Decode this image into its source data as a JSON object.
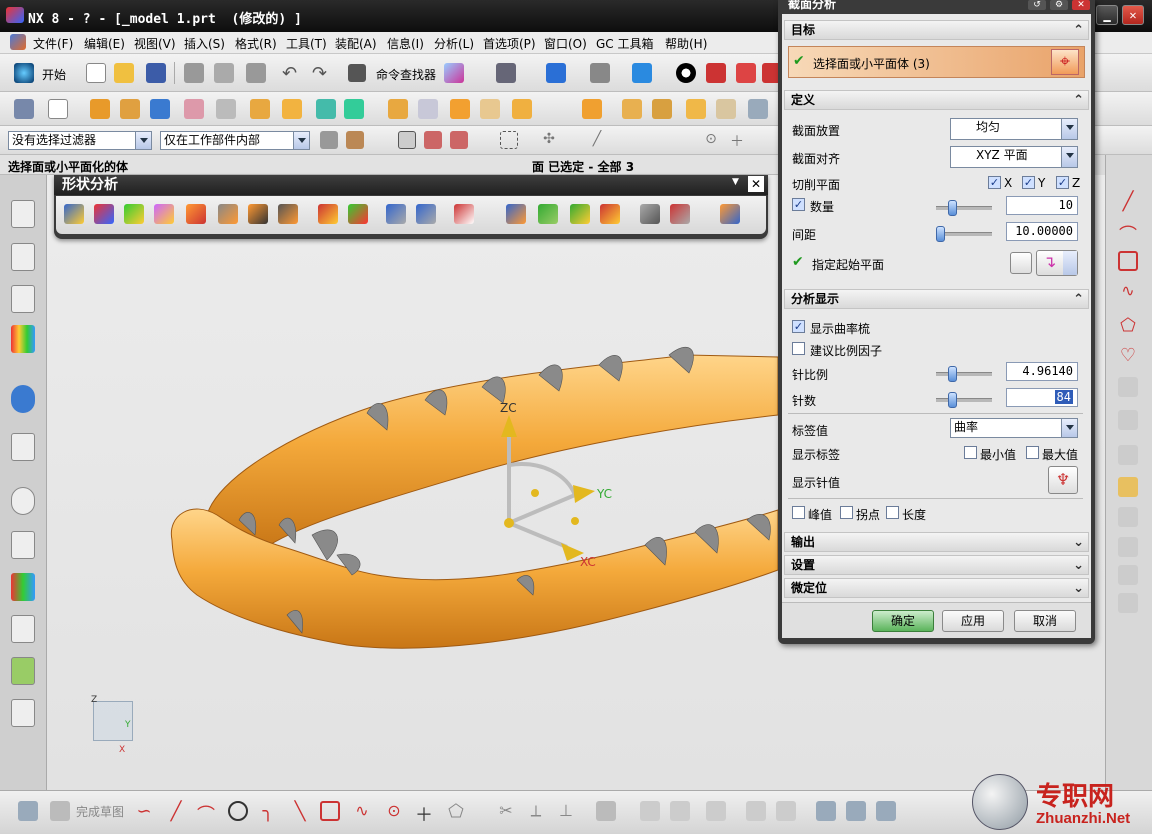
{
  "window": {
    "title": "NX 8 - ? - [_model 1.prt  (修改的) ]"
  },
  "menu": [
    "文件(F)",
    "编辑(E)",
    "视图(V)",
    "插入(S)",
    "格式(R)",
    "工具(T)",
    "装配(A)",
    "信息(I)",
    "分析(L)",
    "首选项(P)",
    "窗口(O)",
    "GC 工具箱",
    "帮助(H)"
  ],
  "toolbar": {
    "start_label": "开始",
    "command_finder_label": "命令查找器"
  },
  "filters": {
    "selection_filter": "没有选择过滤器",
    "scope": "仅在工作部件内部"
  },
  "status": {
    "prompt": "选择面或小平面化的体",
    "selection_info": "面 已选定 - 全部 3"
  },
  "shape_analysis": {
    "title": "形状分析"
  },
  "viewport": {
    "axis_zc": "ZC",
    "axis_yc": "YC",
    "axis_xc": "XC",
    "triad_z": "Z",
    "triad_y": "Y",
    "triad_x": "X"
  },
  "dialog": {
    "title": "截面分析",
    "target": {
      "header": "目标",
      "select_label": "选择面或小平面体 (3)"
    },
    "definition": {
      "header": "定义",
      "placement_label": "截面放置",
      "placement_value": "均匀",
      "alignment_label": "截面对齐",
      "alignment_value": "XYZ 平面",
      "cut_plane_label": "切削平面",
      "x": "X",
      "y": "Y",
      "z": "Z",
      "count_label": "数量",
      "count_value": "10",
      "spacing_label": "间距",
      "spacing_value": "10.00000",
      "start_plane_label": "指定起始平面"
    },
    "display": {
      "header": "分析显示",
      "show_comb_label": "显示曲率梳",
      "suggest_scale_label": "建议比例因子",
      "needle_scale_label": "针比例",
      "needle_scale_value": "4.96140",
      "needle_count_label": "针数",
      "needle_count_value": "84",
      "label_value_label": "标签值",
      "label_value_value": "曲率",
      "show_labels_label": "显示标签",
      "min_label": "最小值",
      "max_label": "最大值",
      "show_needle_label": "显示针值",
      "peak_label": "峰值",
      "inflection_label": "拐点",
      "length_label": "长度"
    },
    "output_header": "输出",
    "settings_header": "设置",
    "fine_position_header": "微定位",
    "ok_label": "确定",
    "apply_label": "应用",
    "cancel_label": "取消"
  },
  "bottom": {
    "finish_sketch_label": "完成草图"
  },
  "watermark": {
    "brand": "专职网",
    "url": "Zhuanzhi.Net"
  },
  "colors": {
    "model_orange": "#f4a93b",
    "accent_blue": "#2f5cb8",
    "dark_frame": "#3a3a3a"
  }
}
